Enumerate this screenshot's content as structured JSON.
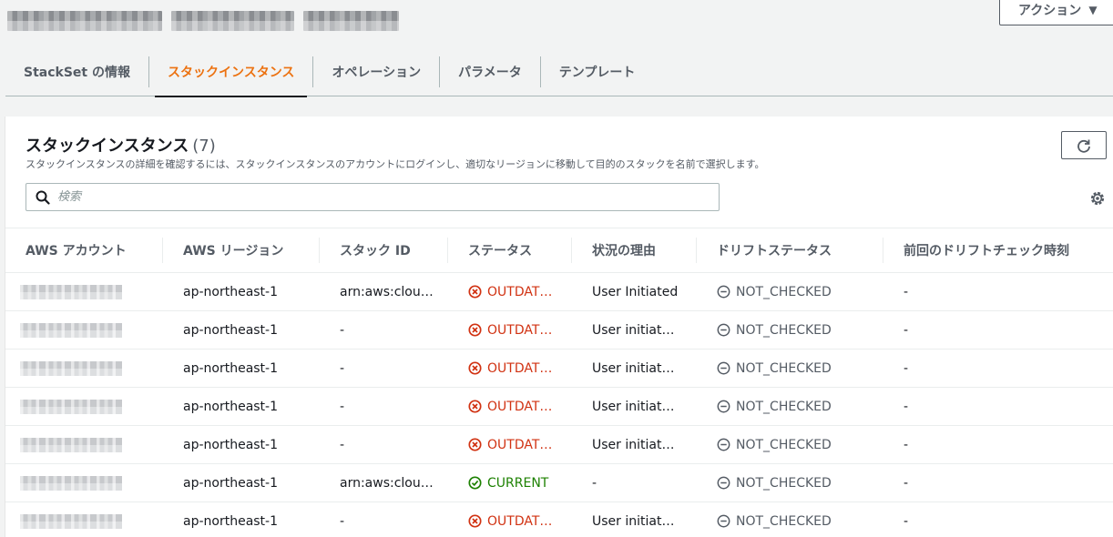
{
  "header": {
    "action_label": "アクション"
  },
  "tabs": [
    {
      "label": "StackSet の情報"
    },
    {
      "label": "スタックインスタンス"
    },
    {
      "label": "オペレーション"
    },
    {
      "label": "パラメータ"
    },
    {
      "label": "テンプレート"
    }
  ],
  "panel": {
    "title": "スタックインスタンス",
    "count": "(7)",
    "description": "スタックインスタンスの詳細を確認するには、スタックインスタンスのアカウントにログインし、適切なリージョンに移動して目的のスタックを名前で選択します。",
    "search_placeholder": "検索"
  },
  "table": {
    "columns": [
      "AWS アカウント",
      "AWS リージョン",
      "スタック ID",
      "ステータス",
      "状況の理由",
      "ドリフトステータス",
      "前回のドリフトチェック時刻"
    ],
    "rows": [
      {
        "region": "ap-northeast-1",
        "stack_id": "arn:aws:clou…",
        "status": "OUTDAT…",
        "reason": "User Initiated",
        "drift": "NOT_CHECKED",
        "last_check": "-"
      },
      {
        "region": "ap-northeast-1",
        "stack_id": "-",
        "status": "OUTDAT…",
        "reason": "User initiat…",
        "drift": "NOT_CHECKED",
        "last_check": "-"
      },
      {
        "region": "ap-northeast-1",
        "stack_id": "-",
        "status": "OUTDAT…",
        "reason": "User initiat…",
        "drift": "NOT_CHECKED",
        "last_check": "-"
      },
      {
        "region": "ap-northeast-1",
        "stack_id": "-",
        "status": "OUTDAT…",
        "reason": "User initiat…",
        "drift": "NOT_CHECKED",
        "last_check": "-"
      },
      {
        "region": "ap-northeast-1",
        "stack_id": "-",
        "status": "OUTDAT…",
        "reason": "User initiat…",
        "drift": "NOT_CHECKED",
        "last_check": "-"
      },
      {
        "region": "ap-northeast-1",
        "stack_id": "arn:aws:clou…",
        "status": "CURRENT",
        "reason": "-",
        "drift": "NOT_CHECKED",
        "last_check": "-"
      },
      {
        "region": "ap-northeast-1",
        "stack_id": "-",
        "status": "OUTDAT…",
        "reason": "User initiat…",
        "drift": "NOT_CHECKED",
        "last_check": "-"
      }
    ]
  },
  "colors": {
    "accent": "#ec7211",
    "error": "#d13212",
    "success": "#1d8102"
  }
}
